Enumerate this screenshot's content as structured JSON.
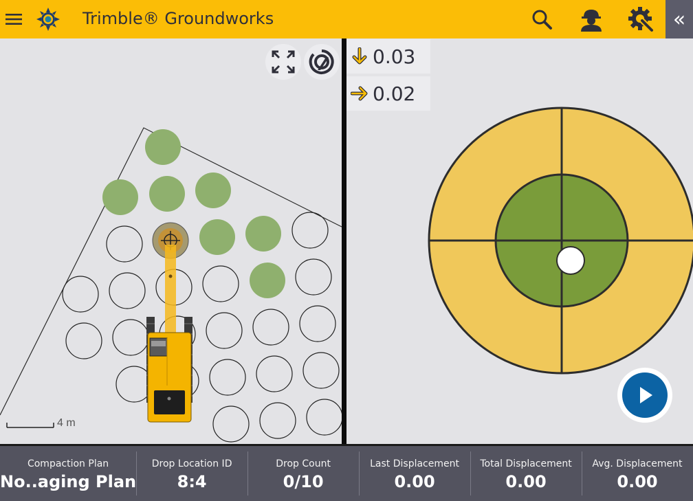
{
  "app": {
    "title": "Trimble® Groundworks",
    "icons": [
      "hamburger-menu-icon",
      "trimble-logo-icon",
      "search-icon",
      "worker-hardhat-icon",
      "settings-gear-wrench-icon",
      "collapse-chevrons-icon"
    ],
    "accent_color": "#fbbd06"
  },
  "map": {
    "fullscreen_icon": "expand-arrows-icon",
    "compass_icon": "compass-lock-icon",
    "scale_label": "4 m",
    "completed_color": "#8fb06e"
  },
  "offsets": {
    "vertical": {
      "icon": "arrow-down-icon",
      "value": "0.03"
    },
    "horizontal": {
      "icon": "arrow-right-icon",
      "value": "0.02"
    }
  },
  "target": {
    "outer_color": "#f0c85a",
    "inner_color": "#7a9c3a"
  },
  "play_button": {
    "icon": "play-icon",
    "color": "#0c63a4"
  },
  "stats": [
    {
      "label": "Compaction Plan",
      "value": "No..aging Plan"
    },
    {
      "label": "Drop Location ID",
      "value": "8:4"
    },
    {
      "label": "Drop Count",
      "value": "0/10"
    },
    {
      "label": "Last Displacement",
      "value": "0.00"
    },
    {
      "label": "Total Displacement",
      "value": "0.00"
    },
    {
      "label": "Avg. Displacement",
      "value": "0.00"
    }
  ]
}
